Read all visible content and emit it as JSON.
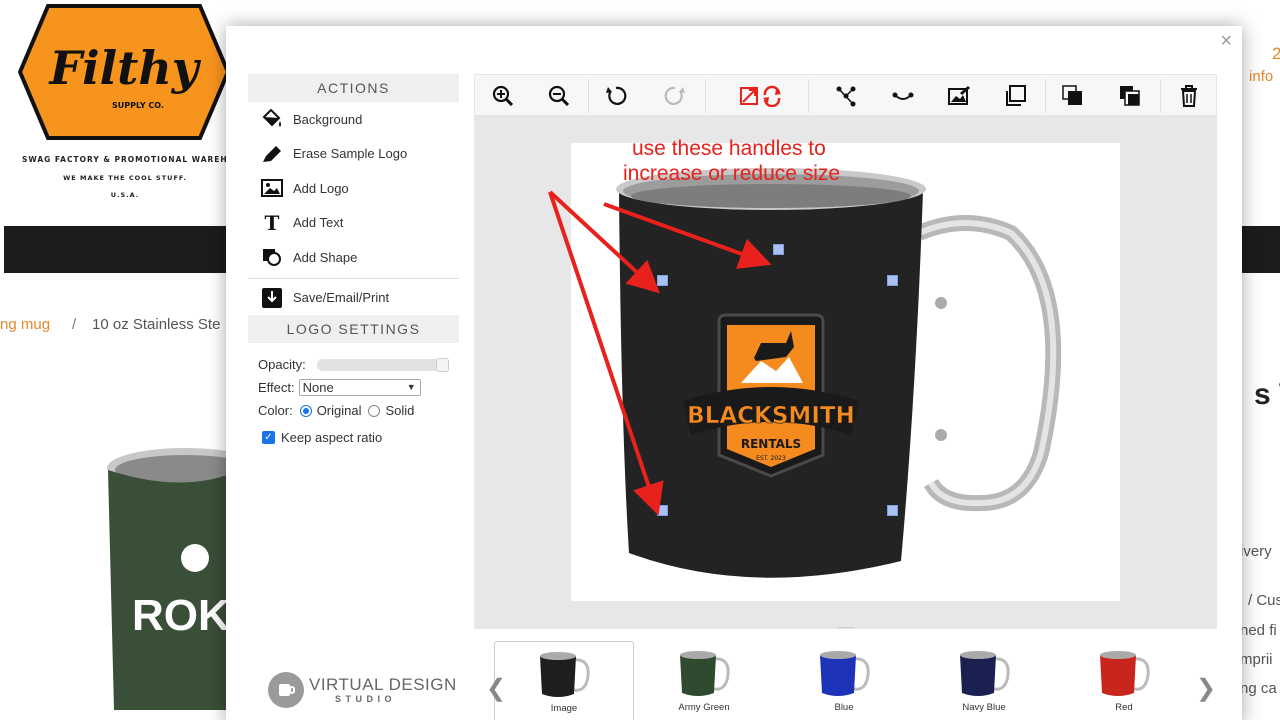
{
  "background_page": {
    "logo_text": "Filthy",
    "logo_sub": "SUPPLY CO.",
    "tagline": "SWAG FACTORY & PROMOTIONAL WAREHO",
    "slogan": "WE MAKE THE COOL STUFF.",
    "country": "U.S.A.",
    "breadcrumb": [
      "ng mug",
      "/",
      "10 oz Stainless Ste"
    ],
    "right_fragments": [
      "2",
      "info",
      "s W",
      "ivery",
      "/ Cust",
      "ned fi",
      "mprii",
      "ng ca"
    ],
    "product_text": "ROK"
  },
  "modal": {
    "close_label": "×",
    "actions_header": "ACTIONS",
    "actions": [
      {
        "label": "Background",
        "icon": "paint-bucket-icon"
      },
      {
        "label": "Erase Sample Logo",
        "icon": "marker-icon"
      },
      {
        "label": "Add Logo",
        "icon": "image-icon"
      },
      {
        "label": "Add Text",
        "icon": "text-icon"
      },
      {
        "label": "Add Shape",
        "icon": "shape-icon"
      }
    ],
    "save_label": "Save/Email/Print",
    "settings_header": "LOGO SETTINGS",
    "opacity_label": "Opacity:",
    "opacity_value": 1.0,
    "effect_label": "Effect:",
    "effect_value": "None",
    "color_label": "Color:",
    "color_options": [
      "Original",
      "Solid"
    ],
    "keep_aspect_label": "Keep aspect ratio",
    "brand_line1": "VIRTUAL DESIGN",
    "brand_line2": "STUDIO",
    "toolbar_icons": [
      "zoom-in-icon",
      "zoom-out-icon",
      "rotate-left-icon",
      "rotate-right-icon",
      "reset-icon",
      "flip-icon",
      "curve-icon",
      "edit-image-icon",
      "duplicate-icon",
      "bring-front-icon",
      "send-back-icon",
      "delete-icon"
    ],
    "logo_on_mug": {
      "line1": "BLACKSMITH",
      "line2": "RENTALS",
      "line3": "EST. 2023"
    },
    "annotation": {
      "line1": "use these handles to",
      "line2": "increase or reduce size"
    },
    "colors": {
      "annotation": "#e8211c",
      "handle": "#a9c2f2",
      "accent": "#1a73e8",
      "brand_orange": "#f7941d"
    },
    "thumbnails": [
      {
        "label": "Image",
        "color": "#1e1e1e",
        "selected": true
      },
      {
        "label": "Army Green",
        "color": "#2f4a2e",
        "selected": false
      },
      {
        "label": "Blue",
        "color": "#1d33b8",
        "selected": false
      },
      {
        "label": "Navy Blue",
        "color": "#1a2150",
        "selected": false
      },
      {
        "label": "Red",
        "color": "#c8261c",
        "selected": false
      }
    ]
  }
}
